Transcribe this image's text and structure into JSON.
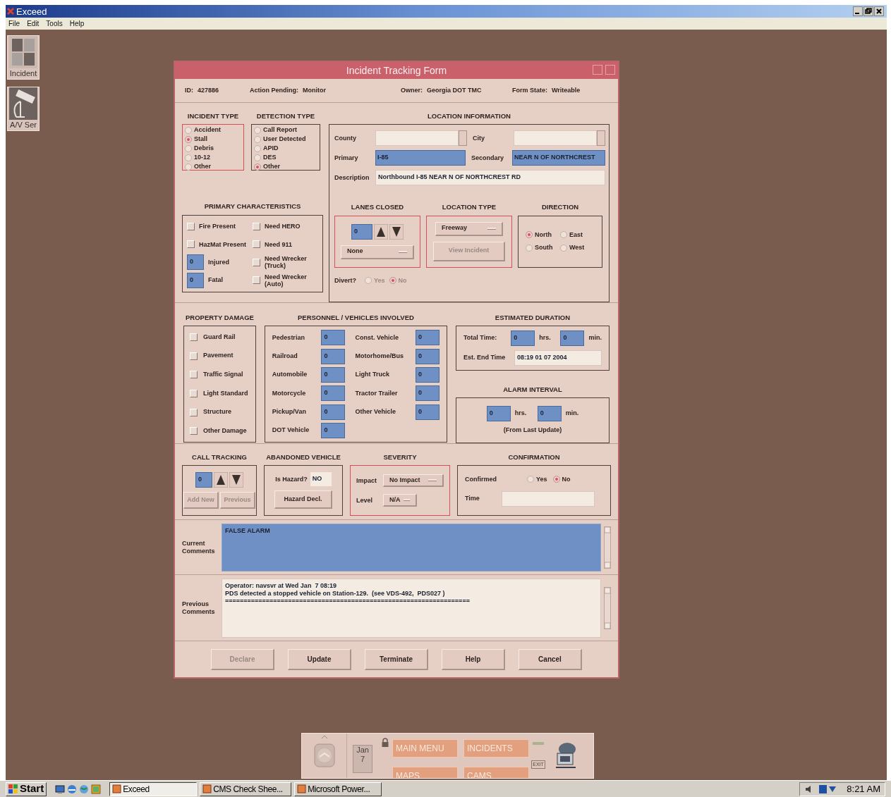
{
  "window": {
    "title": "Exceed",
    "menu": [
      "File",
      "Edit",
      "Tools",
      "Help"
    ]
  },
  "desktop_icons": [
    {
      "label": "Incident",
      "kind": "panes"
    },
    {
      "label": "A/V Ser",
      "kind": "camera"
    }
  ],
  "form": {
    "title": "Incident Tracking Form",
    "header": [
      {
        "label": "ID:",
        "value": "427886"
      },
      {
        "label": "Action Pending:",
        "value": "Monitor"
      },
      {
        "label": "Owner:",
        "value": "Georgia DOT TMC"
      },
      {
        "label": "Form State:",
        "value": "Writeable"
      }
    ],
    "incident_type": {
      "title": "INCIDENT TYPE",
      "highlighted": true,
      "options": [
        {
          "label": "Accident",
          "selected": false
        },
        {
          "label": "Stall",
          "selected": true
        },
        {
          "label": "Debris",
          "selected": false
        },
        {
          "label": "10-12",
          "selected": false
        },
        {
          "label": "Other",
          "selected": false
        }
      ]
    },
    "detection_type": {
      "title": "DETECTION TYPE",
      "highlighted": false,
      "options": [
        {
          "label": "Call Report",
          "selected": false
        },
        {
          "label": "User Detected",
          "selected": false
        },
        {
          "label": "APID",
          "selected": false
        },
        {
          "label": "DES",
          "selected": false
        },
        {
          "label": "Other",
          "selected": true
        }
      ]
    },
    "primary_characteristics": {
      "title": "PRIMARY CHARACTERISTICS",
      "highlighted": false,
      "items": [
        {
          "kind": "checkbox",
          "label": "Fire Present",
          "checked": false
        },
        {
          "kind": "checkbox",
          "label": "Need HERO",
          "checked": false
        },
        {
          "kind": "checkbox",
          "label": "HazMat Present",
          "checked": false
        },
        {
          "kind": "checkbox",
          "label": "Need 911",
          "checked": false
        },
        {
          "kind": "number",
          "label": "Injured",
          "value": "0"
        },
        {
          "kind": "checkbox",
          "label": "Need Wrecker (Truck)",
          "checked": false
        },
        {
          "kind": "number",
          "label": "Fatal",
          "value": "0"
        },
        {
          "kind": "checkbox",
          "label": "Need Wrecker (Auto)",
          "checked": false
        }
      ]
    },
    "location": {
      "title": "LOCATION INFORMATION",
      "highlighted": false,
      "fields": [
        {
          "label": "County",
          "kind": "lookup"
        },
        {
          "label": "City",
          "kind": "lookup"
        },
        {
          "label": "Primary",
          "kind": "selected",
          "value": "I-85"
        },
        {
          "label": "Secondary",
          "kind": "selected",
          "value": "NEAR N OF  NORTHCREST"
        },
        {
          "label": "Description",
          "kind": "text",
          "value": "Northbound I-85 NEAR N OF  NORTHCREST RD"
        }
      ]
    },
    "lanes_closed": {
      "title": "LANES CLOSED",
      "highlighted": true,
      "count": "0",
      "menu": "None"
    },
    "location_type": {
      "title": "LOCATION TYPE",
      "highlighted": true,
      "menu": "Freeway",
      "button": "View Incident",
      "button_disabled": true
    },
    "direction": {
      "title": "DIRECTION",
      "highlighted": false,
      "options": [
        {
          "label": "North",
          "selected": true
        },
        {
          "label": "East",
          "selected": false
        },
        {
          "label": "South",
          "selected": false
        },
        {
          "label": "West",
          "selected": false
        }
      ]
    },
    "divert": {
      "label": "Divert?",
      "disabled": true,
      "options": [
        {
          "label": "Yes",
          "selected": false
        },
        {
          "label": "No",
          "selected": true
        }
      ]
    },
    "property_damage": {
      "title": "PROPERTY DAMAGE",
      "highlighted": false,
      "items": [
        {
          "label": "Guard Rail",
          "checked": false
        },
        {
          "label": "Pavement",
          "checked": false
        },
        {
          "label": "Traffic Signal",
          "checked": false
        },
        {
          "label": "Light Standard",
          "checked": false
        },
        {
          "label": "Structure",
          "checked": false
        },
        {
          "label": "Other Damage",
          "checked": false
        }
      ]
    },
    "personnel": {
      "title": "PERSONNEL / VEHICLES INVOLVED",
      "highlighted": false,
      "items": [
        {
          "label": "Pedestrian",
          "value": "0"
        },
        {
          "label": "Railroad",
          "value": "0"
        },
        {
          "label": "Automobile",
          "value": "0"
        },
        {
          "label": "Motorcycle",
          "value": "0"
        },
        {
          "label": "Pickup/Van",
          "value": "0"
        },
        {
          "label": "DOT Vehicle",
          "value": "0"
        },
        {
          "label": "Const. Vehicle",
          "value": "0"
        },
        {
          "label": "Motorhome/Bus",
          "value": "0"
        },
        {
          "label": "Light Truck",
          "value": "0"
        },
        {
          "label": "Tractor Trailer",
          "value": "0"
        },
        {
          "label": "Other Vehicle",
          "value": "0"
        }
      ]
    },
    "estimated_duration": {
      "title": "ESTIMATED DURATION",
      "highlighted": false,
      "total_label": "Total Time:",
      "hours": "0",
      "hours_unit": "hrs.",
      "minutes": "0",
      "minutes_unit": "min.",
      "end_label": "Est. End Time",
      "end_value": "08:19 01 07 2004"
    },
    "alarm_interval": {
      "title": "ALARM INTERVAL",
      "highlighted": false,
      "hours": "0",
      "hours_unit": "hrs.",
      "minutes": "0",
      "minutes_unit": "min.",
      "note": "(From Last Update)"
    },
    "call_tracking": {
      "title": "CALL TRACKING",
      "highlighted": false,
      "count": "0",
      "buttons": [
        {
          "label": "Add New",
          "disabled": true
        },
        {
          "label": "Previous",
          "disabled": true
        }
      ]
    },
    "abandoned_vehicle": {
      "title": "ABANDONED VEHICLE",
      "highlighted": false,
      "hazard_label": "Is Hazard?",
      "hazard_value": "NO",
      "button": "Hazard Decl."
    },
    "severity": {
      "title": "SEVERITY",
      "highlighted": true,
      "fields": [
        {
          "label": "Impact",
          "value": "No Impact"
        },
        {
          "label": "Level",
          "value": "N/A"
        }
      ]
    },
    "confirmation": {
      "title": "CONFIRMATION",
      "highlighted": false,
      "confirmed_label": "Confirmed",
      "options": [
        {
          "label": "Yes",
          "selected": false
        },
        {
          "label": "No",
          "selected": true
        }
      ],
      "time_label": "Time"
    },
    "current_comments": {
      "label": "Current Comments",
      "text": "FALSE ALARM"
    },
    "previous_comments": {
      "label": "Previous Comments",
      "lines": [
        "Operator: navsvr at Wed Jan  7 08:19",
        "PDS detected a stopped vehicle on Station-129.  (see VDS-492,  PDS027 )",
        "=================================================================="
      ]
    },
    "buttons": [
      {
        "label": "Declare",
        "disabled": true
      },
      {
        "label": "Update",
        "disabled": false
      },
      {
        "label": "Terminate",
        "disabled": false
      },
      {
        "label": "Help",
        "disabled": false
      },
      {
        "label": "Cancel",
        "disabled": false
      }
    ]
  },
  "front_panel": {
    "calendar": {
      "month": "Jan",
      "day": "7"
    },
    "buttons": [
      "MAIN MENU",
      "INCIDENTS",
      "MAPS",
      "CAMS"
    ],
    "exit": "EXIT"
  },
  "taskbar": {
    "start": "Start",
    "tasks": [
      {
        "label": "Exceed",
        "selected": true
      },
      {
        "label": "CMS Check Shee...",
        "selected": false
      },
      {
        "label": "Microsoft Power...",
        "selected": false
      }
    ],
    "clock": "8:21 AM"
  }
}
